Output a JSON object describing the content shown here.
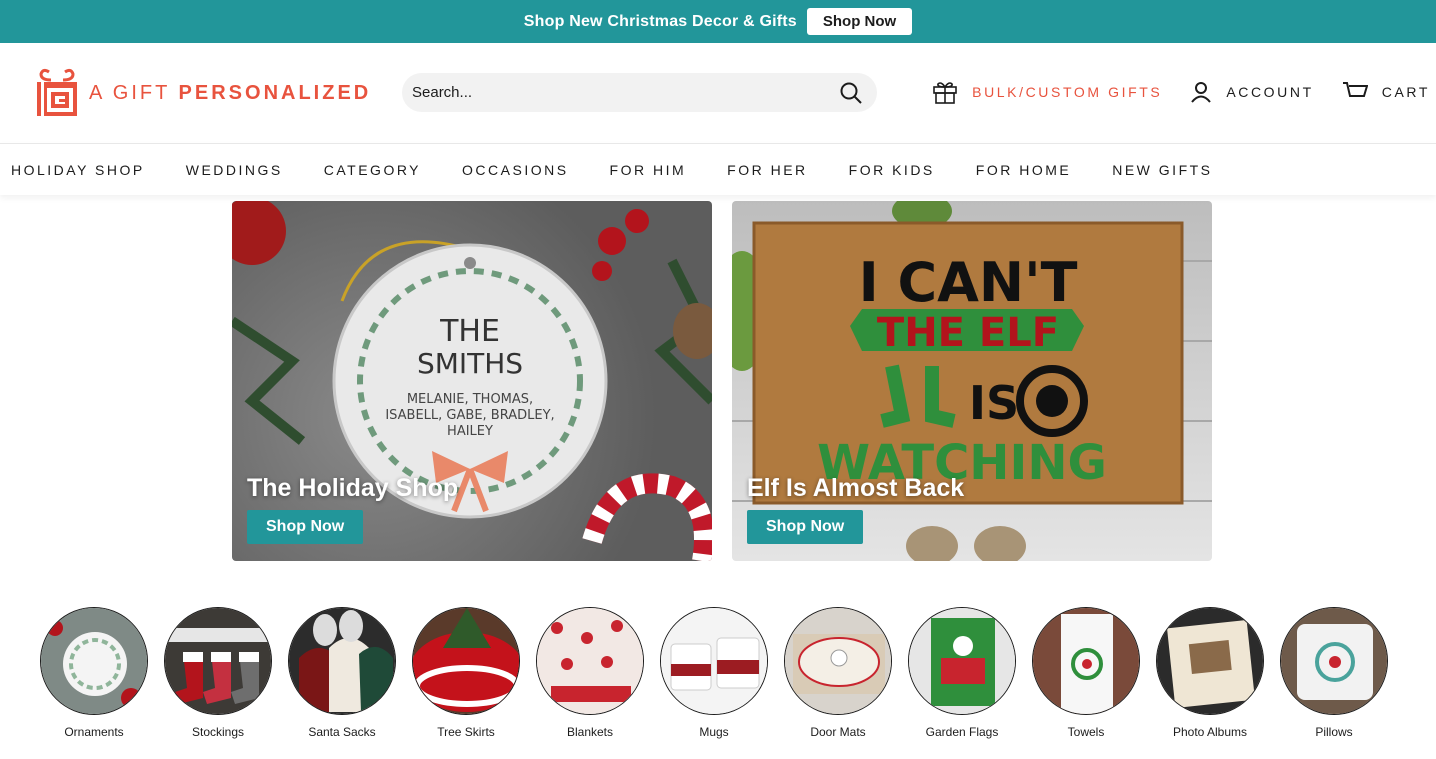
{
  "announcement": {
    "text": "Shop New Christmas Decor & Gifts",
    "button": "Shop Now"
  },
  "brand": {
    "word1": "A GIFT",
    "word2": "PERSONALIZED",
    "accent_color": "#e8533e",
    "teal_color": "#22969a"
  },
  "search": {
    "placeholder": "Search..."
  },
  "header_links": {
    "bulk": "BULK/CUSTOM GIFTS",
    "account": "ACCOUNT",
    "cart": "CART"
  },
  "nav": [
    "HOLIDAY SHOP",
    "WEDDINGS",
    "CATEGORY",
    "OCCASIONS",
    "FOR HIM",
    "FOR HER",
    "FOR KIDS",
    "FOR HOME",
    "NEW GIFTS"
  ],
  "promos": [
    {
      "title": "The Holiday Shop",
      "button": "Shop Now",
      "ornament_lines": [
        "THE",
        "SMITHS",
        "MELANIE, THOMAS,",
        "ISABELL, GABE, BRADLEY,",
        "HAILEY"
      ]
    },
    {
      "title": "Elf Is Almost Back",
      "button": "Shop Now",
      "mat_lines": [
        "I CAN'T",
        "THE ELF",
        "IS",
        "WATCHING"
      ]
    }
  ],
  "categories": [
    {
      "label": "Ornaments",
      "icon": "ornament-icon"
    },
    {
      "label": "Stockings",
      "icon": "stocking-icon"
    },
    {
      "label": "Santa Sacks",
      "icon": "sack-icon"
    },
    {
      "label": "Tree Skirts",
      "icon": "tree-skirt-icon"
    },
    {
      "label": "Blankets",
      "icon": "blanket-icon"
    },
    {
      "label": "Mugs",
      "icon": "mug-icon"
    },
    {
      "label": "Door Mats",
      "icon": "door-mat-icon"
    },
    {
      "label": "Garden Flags",
      "icon": "flag-icon"
    },
    {
      "label": "Towels",
      "icon": "towel-icon"
    },
    {
      "label": "Photo Albums",
      "icon": "album-icon"
    },
    {
      "label": "Pillows",
      "icon": "pillow-icon"
    }
  ]
}
